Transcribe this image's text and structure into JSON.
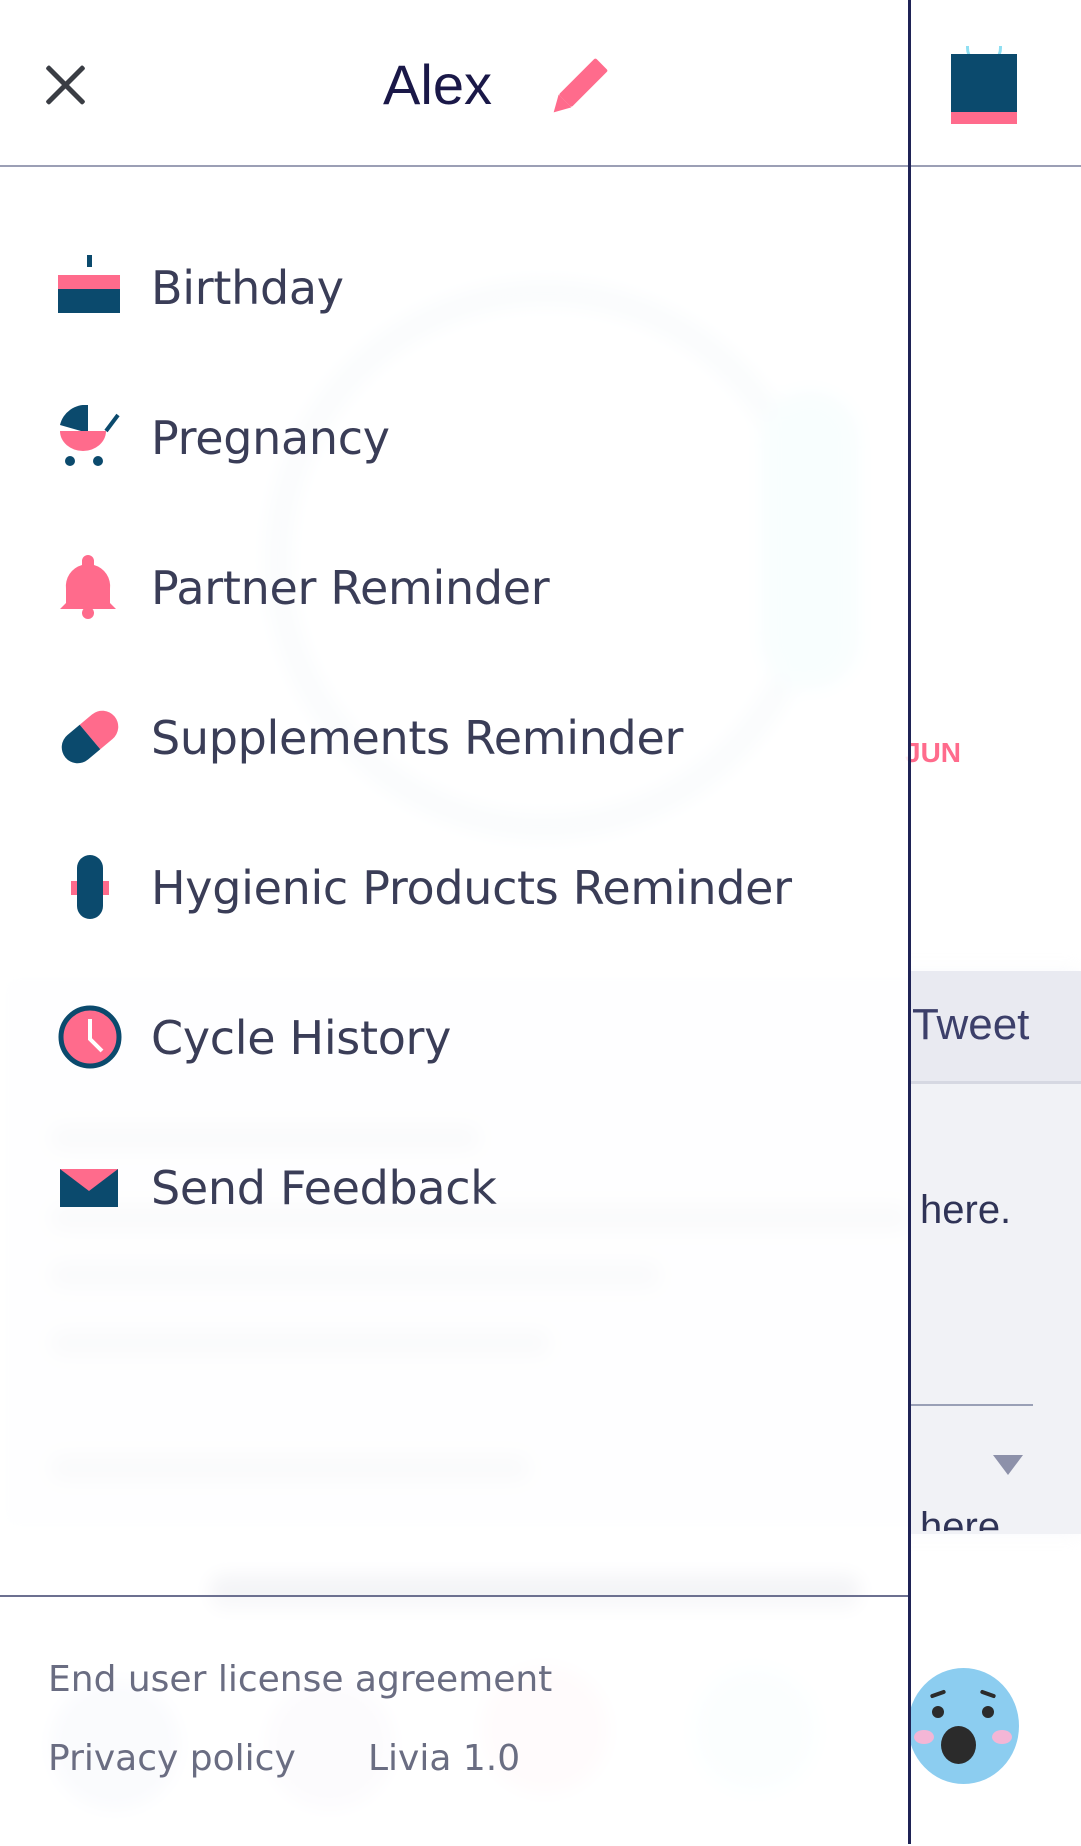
{
  "drawer": {
    "user_name": "Alex",
    "menu": [
      {
        "label": "Birthday",
        "icon": "cake-icon"
      },
      {
        "label": "Pregnancy",
        "icon": "stroller-icon"
      },
      {
        "label": "Partner Reminder",
        "icon": "bell-icon"
      },
      {
        "label": "Supplements Reminder",
        "icon": "pill-icon"
      },
      {
        "label": "Hygienic Products Reminder",
        "icon": "pad-icon"
      },
      {
        "label": "Cycle History",
        "icon": "clock-icon"
      },
      {
        "label": "Send Feedback",
        "icon": "envelope-icon"
      }
    ],
    "footer": {
      "eula": "End user license agreement",
      "privacy": "Privacy policy",
      "version": "Livia 1.0"
    }
  },
  "background": {
    "tweet_label": "Tweet",
    "here_text_1": "here.",
    "here_text_2": "here",
    "month_label": "JUN"
  },
  "colors": {
    "navy": "#0b4a6d",
    "pink": "#ff6b8c",
    "text": "#3a3d57",
    "drawer_border": "#1f2356"
  }
}
